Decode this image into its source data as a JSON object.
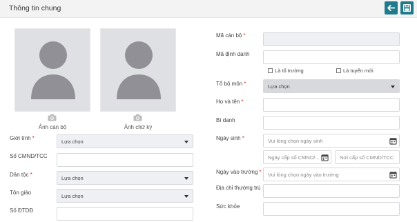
{
  "header": {
    "title": "Thông tin chung"
  },
  "photos": [
    {
      "caption": "Ảnh cán bộ"
    },
    {
      "caption": "Ảnh chữ ký"
    }
  ],
  "left_form": {
    "gender": {
      "label": "Giới tính",
      "value": "Lựa chọn"
    },
    "id_number": {
      "label": "Số CMND/TCC",
      "value": ""
    },
    "ethnicity": {
      "label": "Dân tộc",
      "value": "Lựa chọn"
    },
    "religion": {
      "label": "Tôn giáo",
      "value": "Lựa chọn"
    },
    "phone": {
      "label": "Số ĐTDĐ",
      "value": ""
    }
  },
  "right_form": {
    "staff_code": {
      "label": "Mã cán bộ",
      "value": ""
    },
    "identifier": {
      "label": "Mã định danh",
      "value": ""
    },
    "is_team_leader": {
      "label": "Là tổ trưởng"
    },
    "is_new_hire": {
      "label": "Là tuyển mới"
    },
    "department": {
      "label": "Tổ bộ môn",
      "value": "Lựa chọn"
    },
    "full_name": {
      "label": "Họ và tên",
      "value": ""
    },
    "alias": {
      "label": "Bí danh",
      "value": ""
    },
    "birth_date": {
      "label": "Ngày sinh",
      "placeholder": "Vui lòng chọn ngày sinh"
    },
    "id_issue_date": {
      "placeholder": "Ngày cấp số CMND/..."
    },
    "id_issue_place": {
      "placeholder": "Nơi cấp số CMND/TCC"
    },
    "start_date": {
      "label": "Ngày vào trường",
      "placeholder": "Vui lòng chọn ngày vào trường"
    },
    "address": {
      "label": "Địa chỉ thường trú",
      "value": ""
    },
    "health": {
      "label": "Sức khỏe",
      "value": ""
    }
  }
}
